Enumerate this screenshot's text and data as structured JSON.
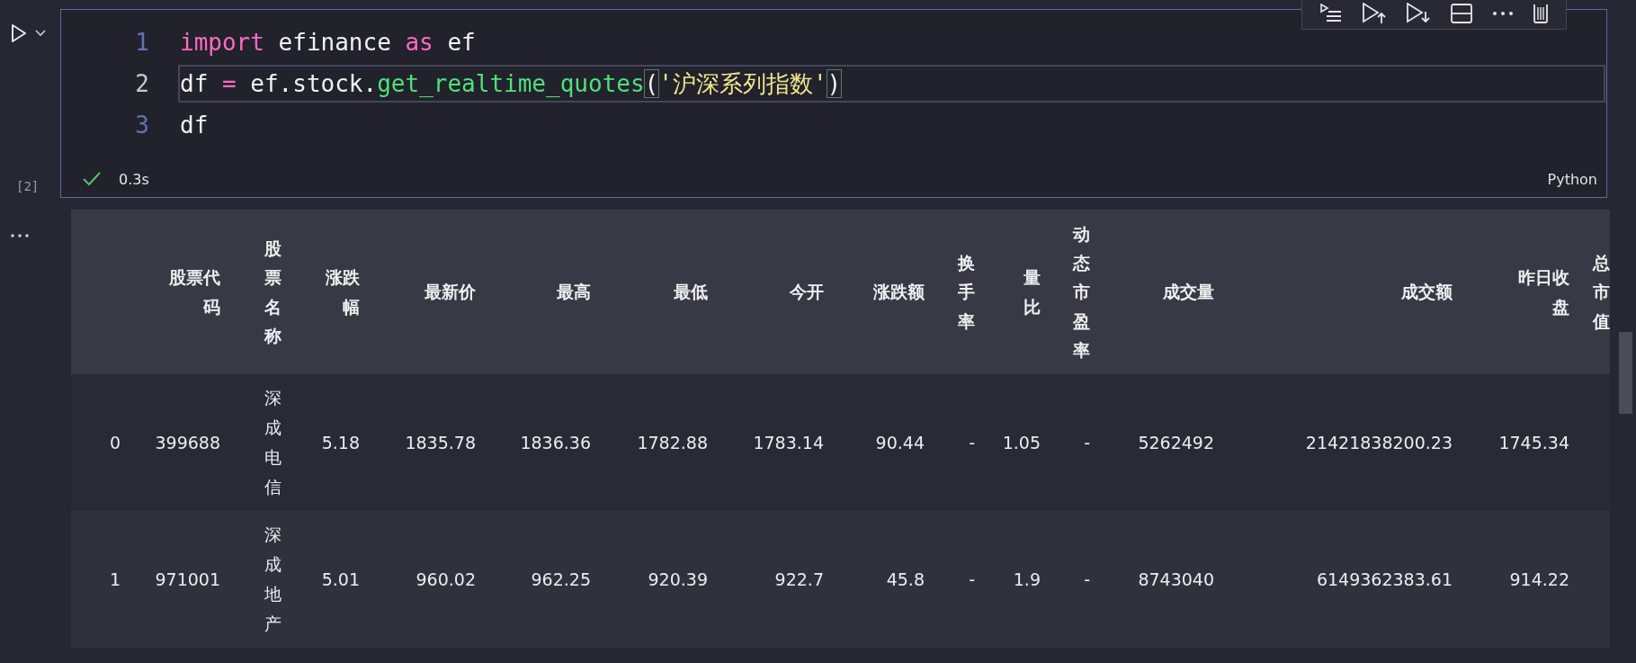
{
  "cell": {
    "execution_count": "[2]",
    "succeeded": true,
    "duration": "0.3s",
    "language": "Python",
    "code_lines": [
      {
        "number": "1",
        "active": false,
        "tokens": [
          {
            "kind": "keyword",
            "text": "import"
          },
          {
            "kind": "plain",
            "text": " efinance "
          },
          {
            "kind": "keyword",
            "text": "as"
          },
          {
            "kind": "plain",
            "text": " ef"
          }
        ]
      },
      {
        "number": "2",
        "active": true,
        "tokens": [
          {
            "kind": "plain",
            "text": "df "
          },
          {
            "kind": "operator",
            "text": "="
          },
          {
            "kind": "plain",
            "text": " ef.stock."
          },
          {
            "kind": "function",
            "text": "get_realtime_quotes"
          },
          {
            "kind": "bracket",
            "text": "("
          },
          {
            "kind": "string",
            "text": "'沪深系列指数'"
          },
          {
            "kind": "bracket",
            "text": ")"
          }
        ]
      },
      {
        "number": "3",
        "active": false,
        "tokens": [
          {
            "kind": "plain",
            "text": "df"
          }
        ]
      }
    ]
  },
  "output": {
    "table": {
      "columns": [
        "股票代码",
        "股票名称",
        "涨跌幅",
        "最新价",
        "最高",
        "最低",
        "今开",
        "涨跌额",
        "换手率",
        "量比",
        "动态市盈率",
        "成交量",
        "成交额",
        "昨日收盘",
        "总市值"
      ],
      "rows": [
        {
          "index": "0",
          "cells": [
            "399688",
            "深成电信",
            "5.18",
            "1835.78",
            "1836.36",
            "1782.88",
            "1783.14",
            "90.44",
            "-",
            "1.05",
            "-",
            "5262492",
            "21421838200.23",
            "1745.34"
          ]
        },
        {
          "index": "1",
          "cells": [
            "971001",
            "深成地产",
            "5.01",
            "960.02",
            "962.25",
            "920.39",
            "922.7",
            "45.8",
            "-",
            "1.9",
            "-",
            "8743040",
            "6149362383.61",
            "914.22"
          ]
        }
      ]
    }
  }
}
